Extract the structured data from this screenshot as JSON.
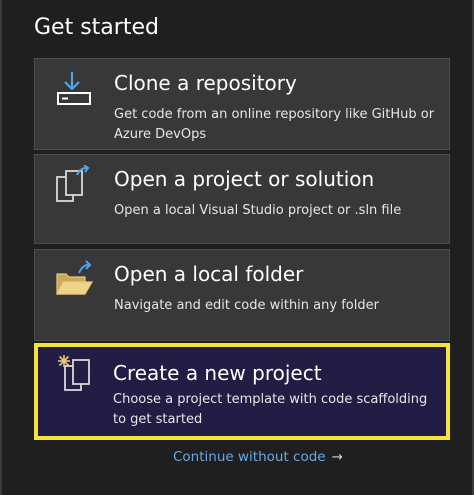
{
  "heading": "Get started",
  "cards": [
    {
      "title": "Clone a repository",
      "description": "Get code from an online repository like GitHub or Azure DevOps",
      "icon": "download-icon"
    },
    {
      "title": "Open a project or solution",
      "description": "Open a local Visual Studio project or .sln file",
      "icon": "open-project-icon"
    },
    {
      "title": "Open a local folder",
      "description": "Navigate and edit code within any folder",
      "icon": "open-folder-icon"
    },
    {
      "title": "Create a new project",
      "description": "Choose a project template with code scaffolding to get started",
      "icon": "new-project-icon",
      "highlighted": true
    }
  ],
  "continue_link": {
    "label": "Continue without code",
    "arrow": "→"
  },
  "colors": {
    "background": "#1f1f1f",
    "card": "#383838",
    "highlight_card": "#231c45",
    "highlight_border": "#f3e33a",
    "link": "#68a8e6",
    "icon_accent": "#4ea3e8",
    "folder": "#e8c77a"
  }
}
